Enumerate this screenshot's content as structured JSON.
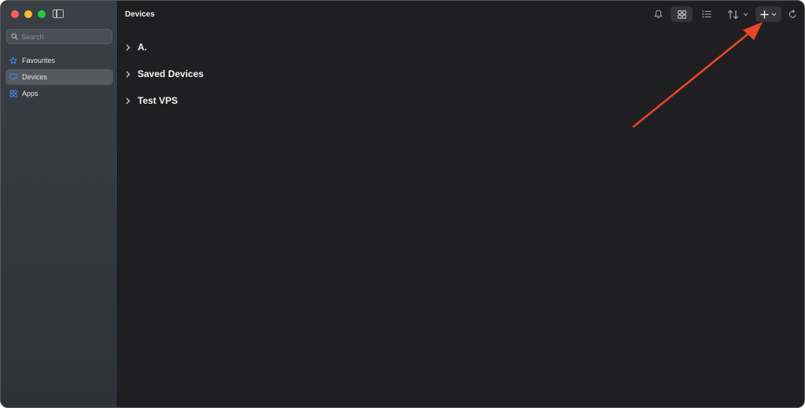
{
  "sidebar": {
    "search_placeholder": "Search",
    "items": [
      {
        "label": "Favourites",
        "icon": "star-icon",
        "active": false
      },
      {
        "label": "Devices",
        "icon": "monitor-icon",
        "active": true
      },
      {
        "label": "Apps",
        "icon": "apps-grid-icon",
        "active": false
      }
    ]
  },
  "header": {
    "title": "Devices"
  },
  "groups": [
    {
      "label": "A."
    },
    {
      "label": "Saved Devices"
    },
    {
      "label": "Test VPS"
    }
  ],
  "colors": {
    "accent_blue": "#3b8ef0",
    "annotation_arrow": "#e8452a",
    "traffic_red": "#ff5f57",
    "traffic_yellow": "#febc2e",
    "traffic_green": "#28c840"
  }
}
